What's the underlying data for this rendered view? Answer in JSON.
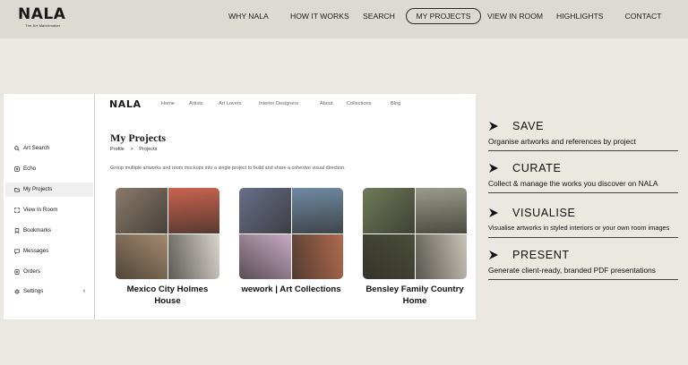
{
  "brand": {
    "name": "NALA",
    "tagline": "The Art Matchmaker"
  },
  "top_nav": [
    {
      "label": "WHY NALA",
      "active": false
    },
    {
      "label": "HOW IT WORKS",
      "active": false
    },
    {
      "label": "SEARCH",
      "active": false
    },
    {
      "label": "MY PROJECTS",
      "active": true
    },
    {
      "label": "VIEW IN ROOM",
      "active": false
    },
    {
      "label": "HIGHLIGHTS",
      "active": false
    },
    {
      "label": "CONTACT",
      "active": false
    }
  ],
  "app": {
    "logo": "NALA",
    "nav": [
      "Home",
      "Artists",
      "Art Lovers",
      "Interior Designers",
      "About",
      "Collections",
      "Blog"
    ],
    "sidebar": [
      {
        "label": "Art Search",
        "icon": "search-icon",
        "active": false
      },
      {
        "label": "Echo",
        "icon": "echo-icon",
        "active": false
      },
      {
        "label": "My Projects",
        "icon": "folder-icon",
        "active": true
      },
      {
        "label": "View In Room",
        "icon": "expand-icon",
        "active": false
      },
      {
        "label": "Bookmarks",
        "icon": "bookmark-icon",
        "active": false
      },
      {
        "label": "Messages",
        "icon": "message-icon",
        "active": false
      },
      {
        "label": "Orders",
        "icon": "orders-icon",
        "active": false
      },
      {
        "label": "Settings",
        "icon": "gear-icon",
        "active": false
      }
    ],
    "page_title": "My Projects",
    "breadcrumb": [
      "Profile",
      ">",
      "Projects"
    ],
    "description": "Group multiple artworks and room mockups into a single project to build and share a cohesive visual direction.",
    "projects": [
      {
        "name": "Mexico City Holmes House",
        "colors": [
          "#8a7a6a",
          "#c9634f",
          "#a58a6c",
          "#d9d4cc"
        ]
      },
      {
        "name": "wework | Art Collections",
        "colors": [
          "#6a6f8a",
          "#6f8aa4",
          "#c9a9c4",
          "#b06a4e"
        ]
      },
      {
        "name": "Bensley Family Country Home",
        "colors": [
          "#6f7b58",
          "#9a9c8a",
          "#4a4d38",
          "#c9c4b8"
        ]
      }
    ]
  },
  "features": [
    {
      "title": "SAVE",
      "text": "Organise artworks and references by project"
    },
    {
      "title": "CURATE",
      "text": "Collect & manage the works you discover on NALA"
    },
    {
      "title": "VISUALISE",
      "text": "Visualise artworks in styled interiors or your own room images"
    },
    {
      "title": "PRESENT",
      "text": "Generate client-ready, branded PDF presentations"
    }
  ]
}
